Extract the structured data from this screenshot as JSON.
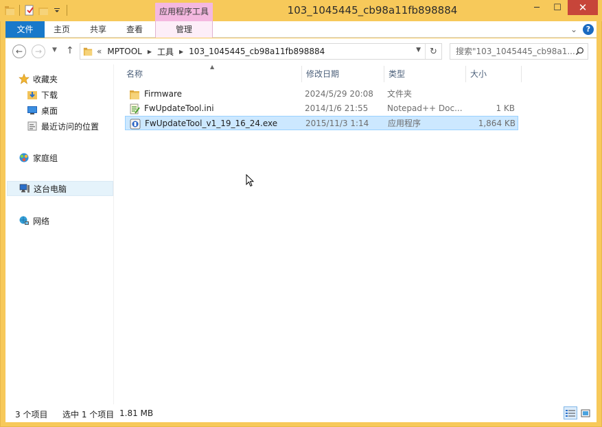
{
  "window": {
    "title": "103_1045445_cb98a11fb898884",
    "context_tab_group": "应用程序工具",
    "buttons": {
      "minimize": "─",
      "maximize": "☐",
      "close": "✕"
    }
  },
  "ribbon": {
    "tabs": [
      "文件",
      "主页",
      "共享",
      "查看",
      "管理"
    ],
    "collapse": "⌄",
    "help": "?"
  },
  "address": {
    "back": "←",
    "forward": "→",
    "up": "↑",
    "prefix": "«",
    "crumbs": [
      "MPTOOL",
      "工具",
      "103_1045445_cb98a11fb898884"
    ],
    "search_placeholder": "搜索\"103_1045445_cb98a1...",
    "refresh": "↻"
  },
  "nav": {
    "favorites": "收藏夹",
    "favorites_items": [
      "下载",
      "桌面",
      "最近访问的位置"
    ],
    "homegroup": "家庭组",
    "this_pc": "这台电脑",
    "network": "网络"
  },
  "columns": {
    "name": "名称",
    "date": "修改日期",
    "type": "类型",
    "size": "大小"
  },
  "files": [
    {
      "name": "Firmware",
      "date": "2024/5/29 20:08",
      "type": "文件夹",
      "size": "",
      "icon": "folder-icon"
    },
    {
      "name": "FwUpdateTool.ini",
      "date": "2014/1/6 21:55",
      "type": "Notepad++ Doc...",
      "size": "1 KB",
      "icon": "ini-file-icon"
    },
    {
      "name": "FwUpdateTool_v1_19_16_24.exe",
      "date": "2015/11/3 1:14",
      "type": "应用程序",
      "size": "1,864 KB",
      "icon": "exe-file-icon"
    }
  ],
  "status": {
    "count": "3 个项目",
    "selection": "选中 1 个项目",
    "size": "1.81 MB"
  },
  "colors": {
    "title_bar": "#f7c95a",
    "file_tab": "#1979ca",
    "context_tab": "#f4b8e0",
    "selection": "#cce8ff"
  }
}
